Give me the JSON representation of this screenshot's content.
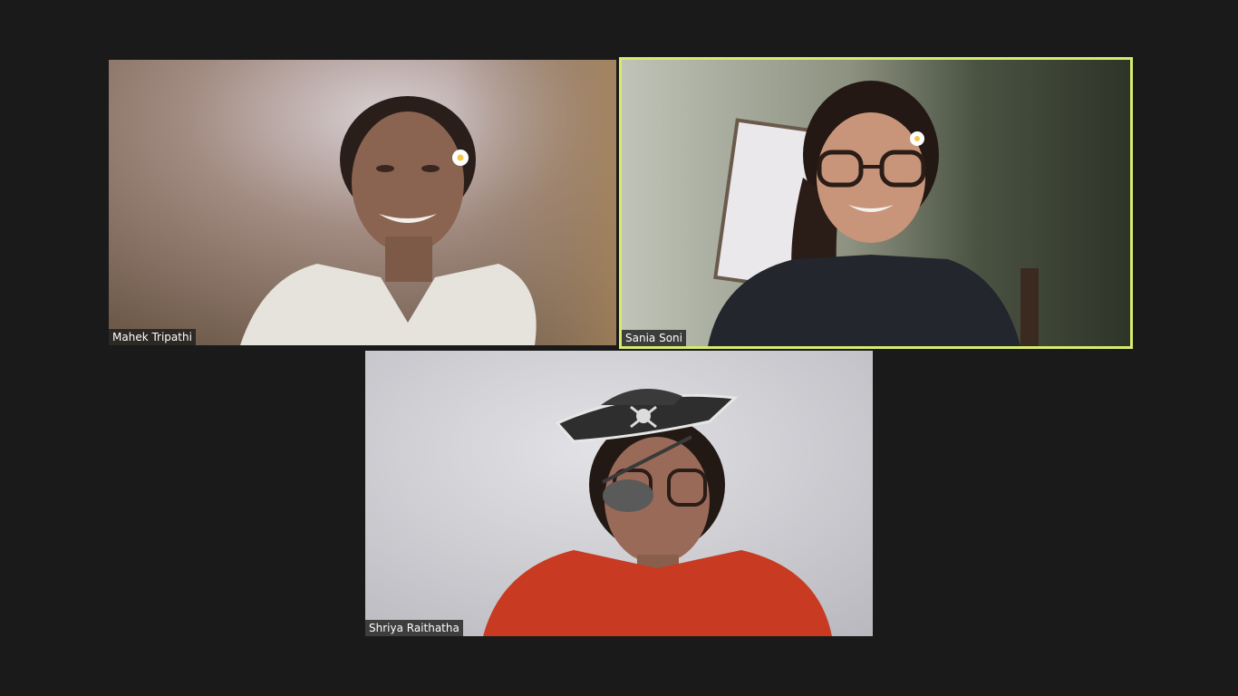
{
  "meeting": {
    "view": "gallery",
    "active_speaker_border_color": "#d6ec6c",
    "background_color": "#1a1a1a",
    "participants": [
      {
        "name": "Mahek Tripathi",
        "active_speaker": false,
        "video_on": true
      },
      {
        "name": "Sania Soni",
        "active_speaker": true,
        "video_on": true
      },
      {
        "name": "Shriya Raithatha",
        "active_speaker": false,
        "video_on": true
      }
    ]
  }
}
